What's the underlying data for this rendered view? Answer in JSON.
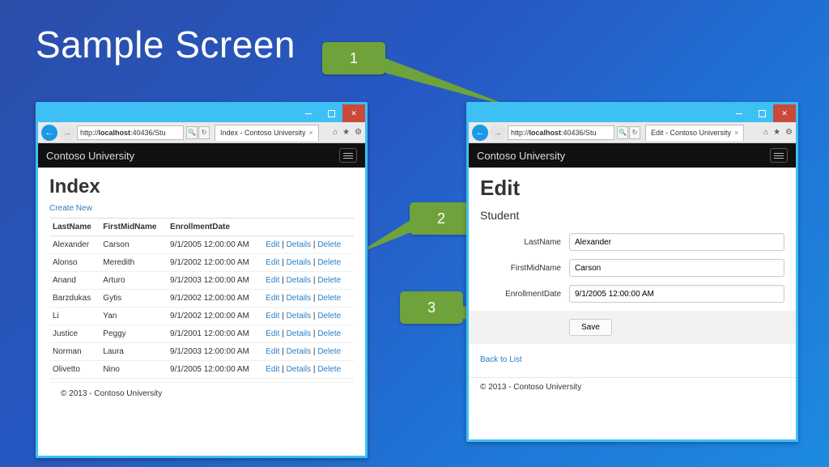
{
  "slide": {
    "title": "Sample Screen"
  },
  "callouts": {
    "n1": "1",
    "n2": "2",
    "n3": "3"
  },
  "browserLeft": {
    "url_prefix": "http://",
    "url_host": "localhost",
    "url_rest": ":40436/Stu",
    "search_glyph": "🔍",
    "refresh_glyph": "↻",
    "tabTitle": "Index - Contoso University",
    "appTitle": "Contoso University",
    "pageHeading": "Index",
    "createNew": "Create New",
    "columns": {
      "c1": "LastName",
      "c2": "FirstMidName",
      "c3": "EnrollmentDate"
    },
    "actions": {
      "edit": "Edit",
      "details": "Details",
      "del": "Delete",
      "sep": " | "
    },
    "rows": [
      {
        "last": "Alexander",
        "first": "Carson",
        "date": "9/1/2005 12:00:00 AM"
      },
      {
        "last": "Alonso",
        "first": "Meredith",
        "date": "9/1/2002 12:00:00 AM"
      },
      {
        "last": "Anand",
        "first": "Arturo",
        "date": "9/1/2003 12:00:00 AM"
      },
      {
        "last": "Barzdukas",
        "first": "Gytis",
        "date": "9/1/2002 12:00:00 AM"
      },
      {
        "last": "Li",
        "first": "Yan",
        "date": "9/1/2002 12:00:00 AM"
      },
      {
        "last": "Justice",
        "first": "Peggy",
        "date": "9/1/2001 12:00:00 AM"
      },
      {
        "last": "Norman",
        "first": "Laura",
        "date": "9/1/2003 12:00:00 AM"
      },
      {
        "last": "Olivetto",
        "first": "Nino",
        "date": "9/1/2005 12:00:00 AM"
      }
    ],
    "footer": "© 2013 - Contoso University"
  },
  "browserRight": {
    "url_prefix": "http://",
    "url_host": "localhost",
    "url_rest": ":40436/Stu",
    "tabTitle": "Edit - Contoso University",
    "appTitle": "Contoso University",
    "pageHeading": "Edit",
    "subHeading": "Student",
    "labels": {
      "last": "LastName",
      "first": "FirstMidName",
      "date": "EnrollmentDate"
    },
    "values": {
      "last": "Alexander",
      "first": "Carson",
      "date": "9/1/2005 12:00:00 AM"
    },
    "saveLabel": "Save",
    "backLabel": "Back to List",
    "footer": "© 2013 - Contoso University"
  }
}
